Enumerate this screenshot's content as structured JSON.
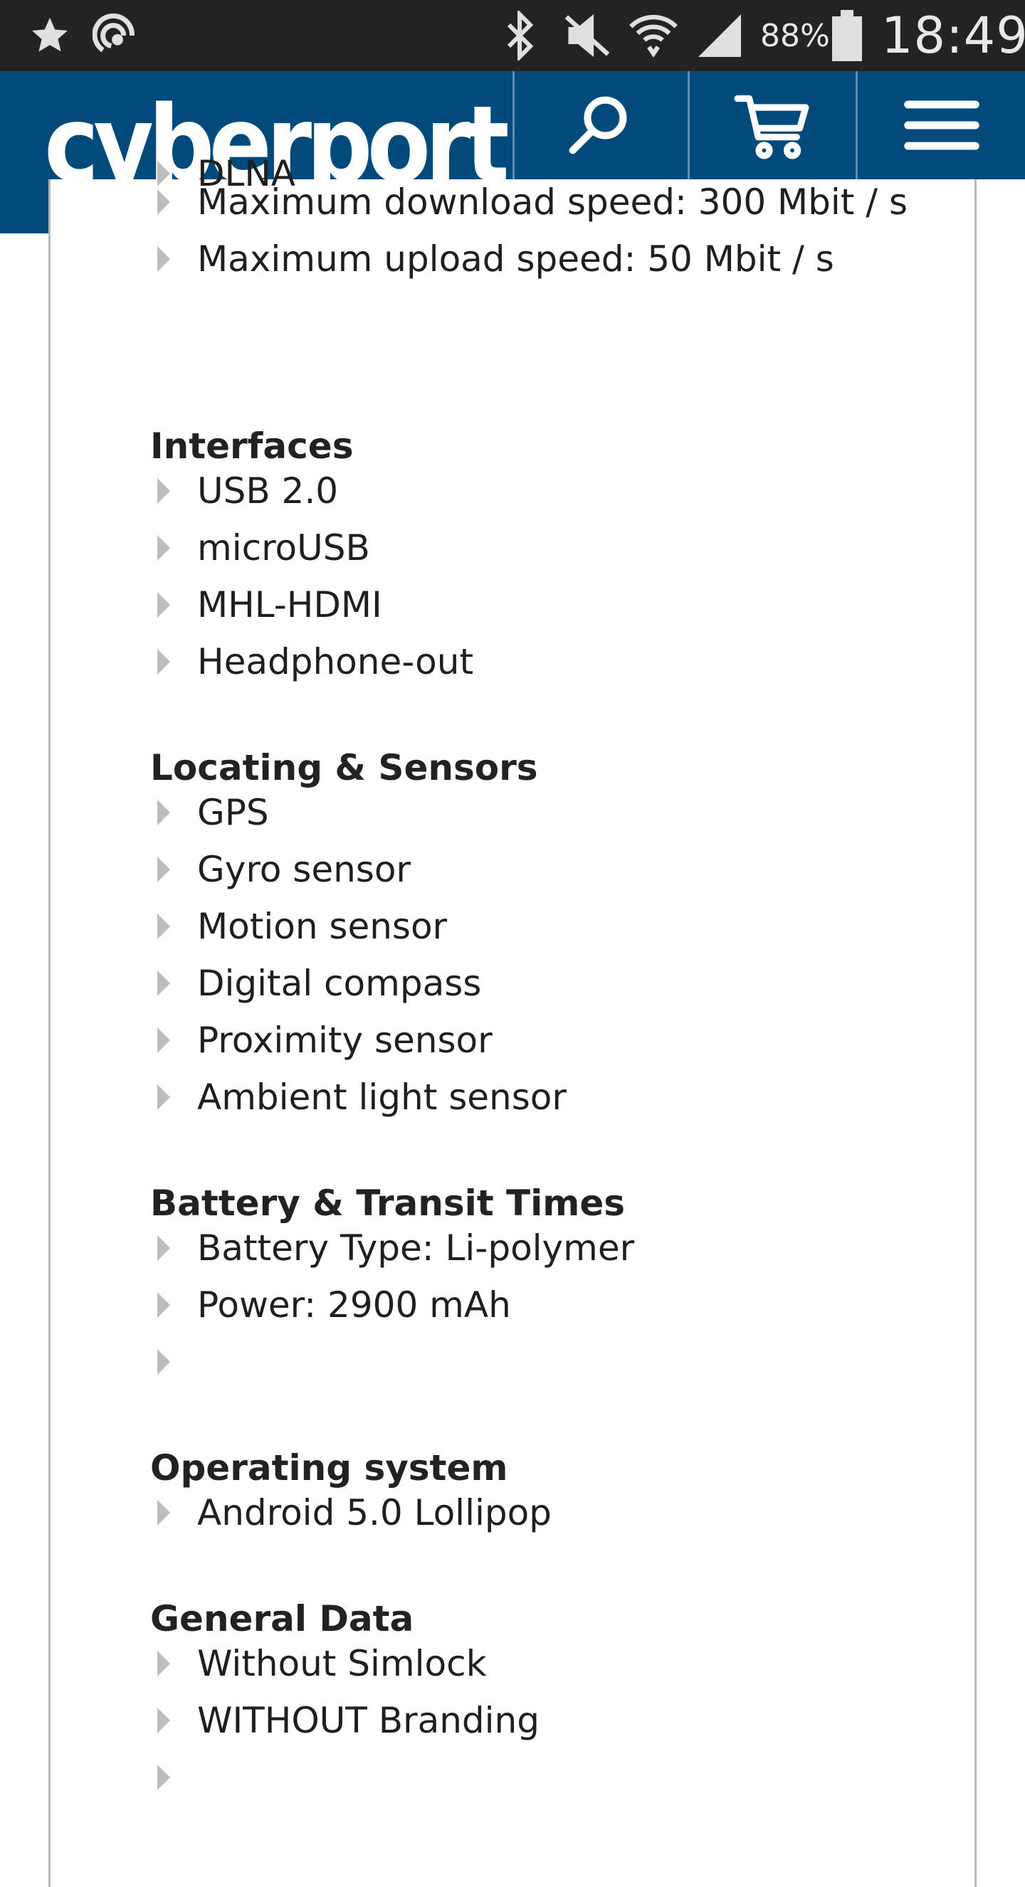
{
  "status_bar": {
    "battery_percent": "88%",
    "time": "18:49",
    "icons": [
      "star-icon",
      "sync-icon",
      "bluetooth-icon",
      "mute-icon",
      "wifi-icon",
      "signal-icon",
      "battery-icon"
    ]
  },
  "header": {
    "logo": "cyberport",
    "brand_color": "#004b7c",
    "buttons": [
      "search-icon",
      "cart-icon",
      "menu-icon"
    ]
  },
  "partial_item": "DLNA",
  "connectivity_items": [
    "Maximum download speed: 300 Mbit / s",
    "Maximum upload speed: 50 Mbit / s"
  ],
  "sections": {
    "interfaces": {
      "title": "Interfaces",
      "items": [
        "USB 2.0",
        "microUSB",
        "MHL-HDMI",
        "Headphone-out"
      ]
    },
    "sensors": {
      "title": "Locating & Sensors",
      "items": [
        "GPS",
        "Gyro sensor",
        "Motion sensor",
        "Digital compass",
        "Proximity sensor",
        "Ambient light sensor"
      ]
    },
    "battery": {
      "title": "Battery & Transit Times",
      "items": [
        "Battery Type: Li-polymer",
        "Power: 2900 mAh",
        ""
      ]
    },
    "os": {
      "title": "Operating system",
      "items": [
        "Android 5.0 Lollipop"
      ]
    },
    "general": {
      "title": "General Data",
      "items": [
        "Without Simlock",
        "WITHOUT Branding",
        ""
      ]
    }
  }
}
